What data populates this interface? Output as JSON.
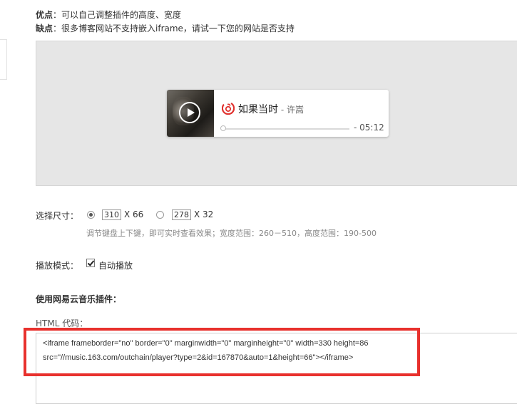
{
  "info": {
    "pro_label": "优点",
    "pro_text": "：可以自己调整插件的高度、宽度",
    "con_label": "缺点",
    "con_text": "：很多博客网站不支持嵌入iframe，请试一下您的网站是否支持"
  },
  "player": {
    "song_title": "如果当时",
    "separator": " - ",
    "artist": "许嵩",
    "duration": "- 05:12",
    "progress_fraction": 0,
    "brand_color": "#e0302d"
  },
  "size": {
    "label": "选择尺寸：",
    "options": [
      {
        "width": "310",
        "suffix": "X 66",
        "selected": true
      },
      {
        "width": "278",
        "suffix": "X 32",
        "selected": false
      }
    ],
    "hint": "调节键盘上下键，即可实时查看效果；宽度范围：260－510，高度范围：190-500"
  },
  "mode": {
    "label": "播放模式：",
    "autoplay_label": "自动播放",
    "autoplay_checked": true
  },
  "embed": {
    "section_title": "使用网易云音乐插件：",
    "html_label": "HTML 代码：",
    "code_line1": "<iframe frameborder=\"no\" border=\"0\" marginwidth=\"0\" marginheight=\"0\" width=330 height=86",
    "code_line2": "src=\"//music.163.com/outchain/player?type=2&id=167870&auto=1&height=66\"></iframe>"
  },
  "colors": {
    "highlight_border": "#e8312d"
  }
}
